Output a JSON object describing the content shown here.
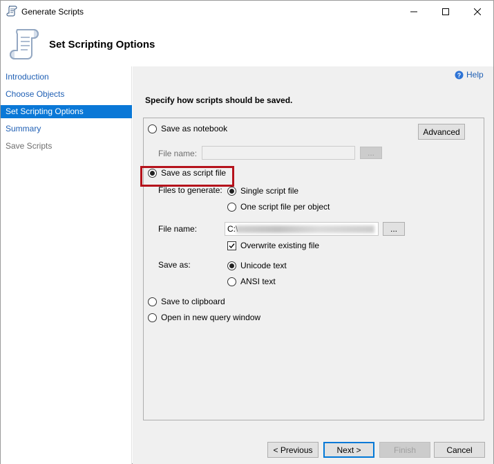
{
  "window": {
    "title": "Generate Scripts",
    "controls": {
      "minimize": "minimize",
      "maximize": "maximize",
      "close": "close"
    }
  },
  "header": {
    "title": "Set Scripting Options",
    "icon": "scroll-icon"
  },
  "sidebar": {
    "items": [
      {
        "label": "Introduction",
        "state": "link"
      },
      {
        "label": "Choose Objects",
        "state": "link"
      },
      {
        "label": "Set Scripting Options",
        "state": "active"
      },
      {
        "label": "Summary",
        "state": "link"
      },
      {
        "label": "Save Scripts",
        "state": "disabled"
      }
    ]
  },
  "main": {
    "help_label": "Help",
    "instruction": "Specify how scripts should be saved.",
    "options": {
      "save_as_notebook": {
        "label": "Save as notebook",
        "selected": false
      },
      "notebook_file_name_label": "File name:",
      "notebook_file_name_value": "",
      "browse_label": "...",
      "advanced_label": "Advanced",
      "save_as_script_file": {
        "label": "Save as script file",
        "selected": true
      },
      "files_to_generate_label": "Files to generate:",
      "single_script_file": {
        "label": "Single script file",
        "selected": true
      },
      "one_file_per_object": {
        "label": "One script file per object",
        "selected": false
      },
      "file_name_label": "File name:",
      "file_name_value": "C:\\",
      "overwrite_existing": {
        "label": "Overwrite existing file",
        "checked": true
      },
      "save_as_label": "Save as:",
      "unicode_text": {
        "label": "Unicode text",
        "selected": true
      },
      "ansi_text": {
        "label": "ANSI text",
        "selected": false
      },
      "save_to_clipboard": {
        "label": "Save to clipboard",
        "selected": false
      },
      "open_in_query_window": {
        "label": "Open in new query window",
        "selected": false
      }
    }
  },
  "footer": {
    "previous_label": "< Previous",
    "next_label": "Next >",
    "finish_label": "Finish",
    "cancel_label": "Cancel"
  },
  "colors": {
    "accent": "#0a78d7",
    "link": "#1f5fb4",
    "highlight_frame": "#b5121b",
    "panel_bg": "#f0f0f0"
  }
}
